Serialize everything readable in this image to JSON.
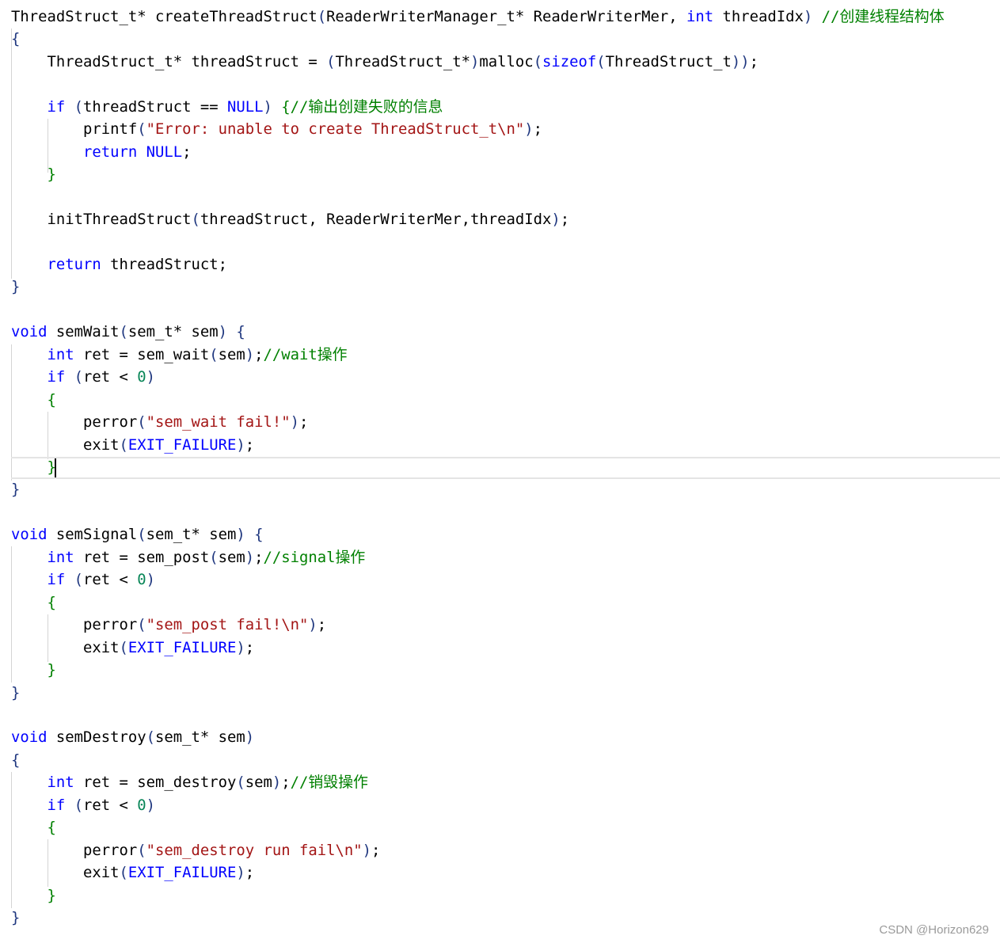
{
  "lines": [
    [
      {
        "t": "ThreadStruct_t* createThreadStruct",
        "c": "tok-punc"
      },
      {
        "t": "(",
        "c": "tok-paren"
      },
      {
        "t": "ReaderWriterManager_t* ReaderWriterMer, ",
        "c": "tok-punc"
      },
      {
        "t": "int",
        "c": "tok-kw"
      },
      {
        "t": " threadIdx",
        "c": "tok-punc"
      },
      {
        "t": ")",
        "c": "tok-paren"
      },
      {
        "t": " //创建线程结构体",
        "c": "tok-cmt"
      }
    ],
    [
      {
        "t": "{",
        "c": "tok-brace"
      }
    ],
    [
      {
        "t": "    ThreadStruct_t* threadStruct = ",
        "c": "tok-punc"
      },
      {
        "t": "(",
        "c": "tok-paren"
      },
      {
        "t": "ThreadStruct_t*",
        "c": "tok-punc"
      },
      {
        "t": ")",
        "c": "tok-paren"
      },
      {
        "t": "malloc",
        "c": "tok-punc"
      },
      {
        "t": "(",
        "c": "tok-paren"
      },
      {
        "t": "sizeof",
        "c": "tok-kw"
      },
      {
        "t": "(",
        "c": "tok-paren"
      },
      {
        "t": "ThreadStruct_t",
        "c": "tok-punc"
      },
      {
        "t": "))",
        "c": "tok-paren"
      },
      {
        "t": ";",
        "c": "tok-punc"
      }
    ],
    [],
    [
      {
        "t": "    ",
        "c": "tok-punc"
      },
      {
        "t": "if",
        "c": "tok-kw"
      },
      {
        "t": " ",
        "c": "tok-punc"
      },
      {
        "t": "(",
        "c": "tok-paren"
      },
      {
        "t": "threadStruct == ",
        "c": "tok-punc"
      },
      {
        "t": "NULL",
        "c": "tok-macro"
      },
      {
        "t": ")",
        "c": "tok-paren"
      },
      {
        "t": " ",
        "c": "tok-punc"
      },
      {
        "t": "{",
        "c": "tok-brace-g"
      },
      {
        "t": "//输出创建失败的信息",
        "c": "tok-cmt"
      }
    ],
    [
      {
        "t": "        printf",
        "c": "tok-punc"
      },
      {
        "t": "(",
        "c": "tok-paren"
      },
      {
        "t": "\"Error: unable to create ThreadStruct_t\\n\"",
        "c": "tok-str"
      },
      {
        "t": ")",
        "c": "tok-paren"
      },
      {
        "t": ";",
        "c": "tok-punc"
      }
    ],
    [
      {
        "t": "        ",
        "c": "tok-punc"
      },
      {
        "t": "return",
        "c": "tok-kw"
      },
      {
        "t": " ",
        "c": "tok-punc"
      },
      {
        "t": "NULL",
        "c": "tok-macro"
      },
      {
        "t": ";",
        "c": "tok-punc"
      }
    ],
    [
      {
        "t": "    ",
        "c": "tok-punc"
      },
      {
        "t": "}",
        "c": "tok-brace-g"
      }
    ],
    [],
    [
      {
        "t": "    initThreadStruct",
        "c": "tok-punc"
      },
      {
        "t": "(",
        "c": "tok-paren"
      },
      {
        "t": "threadStruct, ReaderWriterMer,threadIdx",
        "c": "tok-punc"
      },
      {
        "t": ")",
        "c": "tok-paren"
      },
      {
        "t": ";",
        "c": "tok-punc"
      }
    ],
    [],
    [
      {
        "t": "    ",
        "c": "tok-punc"
      },
      {
        "t": "return",
        "c": "tok-kw"
      },
      {
        "t": " threadStruct;",
        "c": "tok-punc"
      }
    ],
    [
      {
        "t": "}",
        "c": "tok-brace"
      }
    ],
    [],
    [
      {
        "t": "void",
        "c": "tok-kw"
      },
      {
        "t": " semWait",
        "c": "tok-punc"
      },
      {
        "t": "(",
        "c": "tok-paren"
      },
      {
        "t": "sem_t* sem",
        "c": "tok-punc"
      },
      {
        "t": ")",
        "c": "tok-paren"
      },
      {
        "t": " ",
        "c": "tok-punc"
      },
      {
        "t": "{",
        "c": "tok-brace"
      }
    ],
    [
      {
        "t": "    ",
        "c": "tok-punc"
      },
      {
        "t": "int",
        "c": "tok-kw"
      },
      {
        "t": " ret = sem_wait",
        "c": "tok-punc"
      },
      {
        "t": "(",
        "c": "tok-paren"
      },
      {
        "t": "sem",
        "c": "tok-punc"
      },
      {
        "t": ")",
        "c": "tok-paren"
      },
      {
        "t": ";",
        "c": "tok-punc"
      },
      {
        "t": "//wait操作",
        "c": "tok-cmt"
      }
    ],
    [
      {
        "t": "    ",
        "c": "tok-punc"
      },
      {
        "t": "if",
        "c": "tok-kw"
      },
      {
        "t": " ",
        "c": "tok-punc"
      },
      {
        "t": "(",
        "c": "tok-paren"
      },
      {
        "t": "ret < ",
        "c": "tok-punc"
      },
      {
        "t": "0",
        "c": "tok-num"
      },
      {
        "t": ")",
        "c": "tok-paren"
      }
    ],
    [
      {
        "t": "    ",
        "c": "tok-punc"
      },
      {
        "t": "{",
        "c": "tok-brace-g"
      }
    ],
    [
      {
        "t": "        perror",
        "c": "tok-punc"
      },
      {
        "t": "(",
        "c": "tok-paren"
      },
      {
        "t": "\"sem_wait fail!\"",
        "c": "tok-str"
      },
      {
        "t": ")",
        "c": "tok-paren"
      },
      {
        "t": ";",
        "c": "tok-punc"
      }
    ],
    [
      {
        "t": "        exit",
        "c": "tok-punc"
      },
      {
        "t": "(",
        "c": "tok-paren"
      },
      {
        "t": "EXIT_FAILURE",
        "c": "tok-macro"
      },
      {
        "t": ")",
        "c": "tok-paren"
      },
      {
        "t": ";",
        "c": "tok-punc"
      }
    ],
    [
      {
        "t": "    ",
        "c": "tok-punc"
      },
      {
        "t": "}",
        "c": "tok-brace-g"
      }
    ],
    [
      {
        "t": "}",
        "c": "tok-brace"
      }
    ],
    [],
    [
      {
        "t": "void",
        "c": "tok-kw"
      },
      {
        "t": " semSignal",
        "c": "tok-punc"
      },
      {
        "t": "(",
        "c": "tok-paren"
      },
      {
        "t": "sem_t* sem",
        "c": "tok-punc"
      },
      {
        "t": ")",
        "c": "tok-paren"
      },
      {
        "t": " ",
        "c": "tok-punc"
      },
      {
        "t": "{",
        "c": "tok-brace"
      }
    ],
    [
      {
        "t": "    ",
        "c": "tok-punc"
      },
      {
        "t": "int",
        "c": "tok-kw"
      },
      {
        "t": " ret = sem_post",
        "c": "tok-punc"
      },
      {
        "t": "(",
        "c": "tok-paren"
      },
      {
        "t": "sem",
        "c": "tok-punc"
      },
      {
        "t": ")",
        "c": "tok-paren"
      },
      {
        "t": ";",
        "c": "tok-punc"
      },
      {
        "t": "//signal操作",
        "c": "tok-cmt"
      }
    ],
    [
      {
        "t": "    ",
        "c": "tok-punc"
      },
      {
        "t": "if",
        "c": "tok-kw"
      },
      {
        "t": " ",
        "c": "tok-punc"
      },
      {
        "t": "(",
        "c": "tok-paren"
      },
      {
        "t": "ret < ",
        "c": "tok-punc"
      },
      {
        "t": "0",
        "c": "tok-num"
      },
      {
        "t": ")",
        "c": "tok-paren"
      }
    ],
    [
      {
        "t": "    ",
        "c": "tok-punc"
      },
      {
        "t": "{",
        "c": "tok-brace-g"
      }
    ],
    [
      {
        "t": "        perror",
        "c": "tok-punc"
      },
      {
        "t": "(",
        "c": "tok-paren"
      },
      {
        "t": "\"sem_post fail!\\n\"",
        "c": "tok-str"
      },
      {
        "t": ")",
        "c": "tok-paren"
      },
      {
        "t": ";",
        "c": "tok-punc"
      }
    ],
    [
      {
        "t": "        exit",
        "c": "tok-punc"
      },
      {
        "t": "(",
        "c": "tok-paren"
      },
      {
        "t": "EXIT_FAILURE",
        "c": "tok-macro"
      },
      {
        "t": ")",
        "c": "tok-paren"
      },
      {
        "t": ";",
        "c": "tok-punc"
      }
    ],
    [
      {
        "t": "    ",
        "c": "tok-punc"
      },
      {
        "t": "}",
        "c": "tok-brace-g"
      }
    ],
    [
      {
        "t": "}",
        "c": "tok-brace"
      }
    ],
    [],
    [
      {
        "t": "void",
        "c": "tok-kw"
      },
      {
        "t": " semDestroy",
        "c": "tok-punc"
      },
      {
        "t": "(",
        "c": "tok-paren"
      },
      {
        "t": "sem_t* sem",
        "c": "tok-punc"
      },
      {
        "t": ")",
        "c": "tok-paren"
      }
    ],
    [
      {
        "t": "{",
        "c": "tok-brace"
      }
    ],
    [
      {
        "t": "    ",
        "c": "tok-punc"
      },
      {
        "t": "int",
        "c": "tok-kw"
      },
      {
        "t": " ret = sem_destroy",
        "c": "tok-punc"
      },
      {
        "t": "(",
        "c": "tok-paren"
      },
      {
        "t": "sem",
        "c": "tok-punc"
      },
      {
        "t": ")",
        "c": "tok-paren"
      },
      {
        "t": ";",
        "c": "tok-punc"
      },
      {
        "t": "//销毁操作",
        "c": "tok-cmt"
      }
    ],
    [
      {
        "t": "    ",
        "c": "tok-punc"
      },
      {
        "t": "if",
        "c": "tok-kw"
      },
      {
        "t": " ",
        "c": "tok-punc"
      },
      {
        "t": "(",
        "c": "tok-paren"
      },
      {
        "t": "ret < ",
        "c": "tok-punc"
      },
      {
        "t": "0",
        "c": "tok-num"
      },
      {
        "t": ")",
        "c": "tok-paren"
      }
    ],
    [
      {
        "t": "    ",
        "c": "tok-punc"
      },
      {
        "t": "{",
        "c": "tok-brace-g"
      }
    ],
    [
      {
        "t": "        perror",
        "c": "tok-punc"
      },
      {
        "t": "(",
        "c": "tok-paren"
      },
      {
        "t": "\"sem_destroy run fail\\n\"",
        "c": "tok-str"
      },
      {
        "t": ")",
        "c": "tok-paren"
      },
      {
        "t": ";",
        "c": "tok-punc"
      }
    ],
    [
      {
        "t": "        exit",
        "c": "tok-punc"
      },
      {
        "t": "(",
        "c": "tok-paren"
      },
      {
        "t": "EXIT_FAILURE",
        "c": "tok-macro"
      },
      {
        "t": ")",
        "c": "tok-paren"
      },
      {
        "t": ";",
        "c": "tok-punc"
      }
    ],
    [
      {
        "t": "    ",
        "c": "tok-punc"
      },
      {
        "t": "}",
        "c": "tok-brace-g"
      }
    ],
    [
      {
        "t": "}",
        "c": "tok-brace"
      }
    ]
  ],
  "watermark": "CSDN @Horizon629"
}
